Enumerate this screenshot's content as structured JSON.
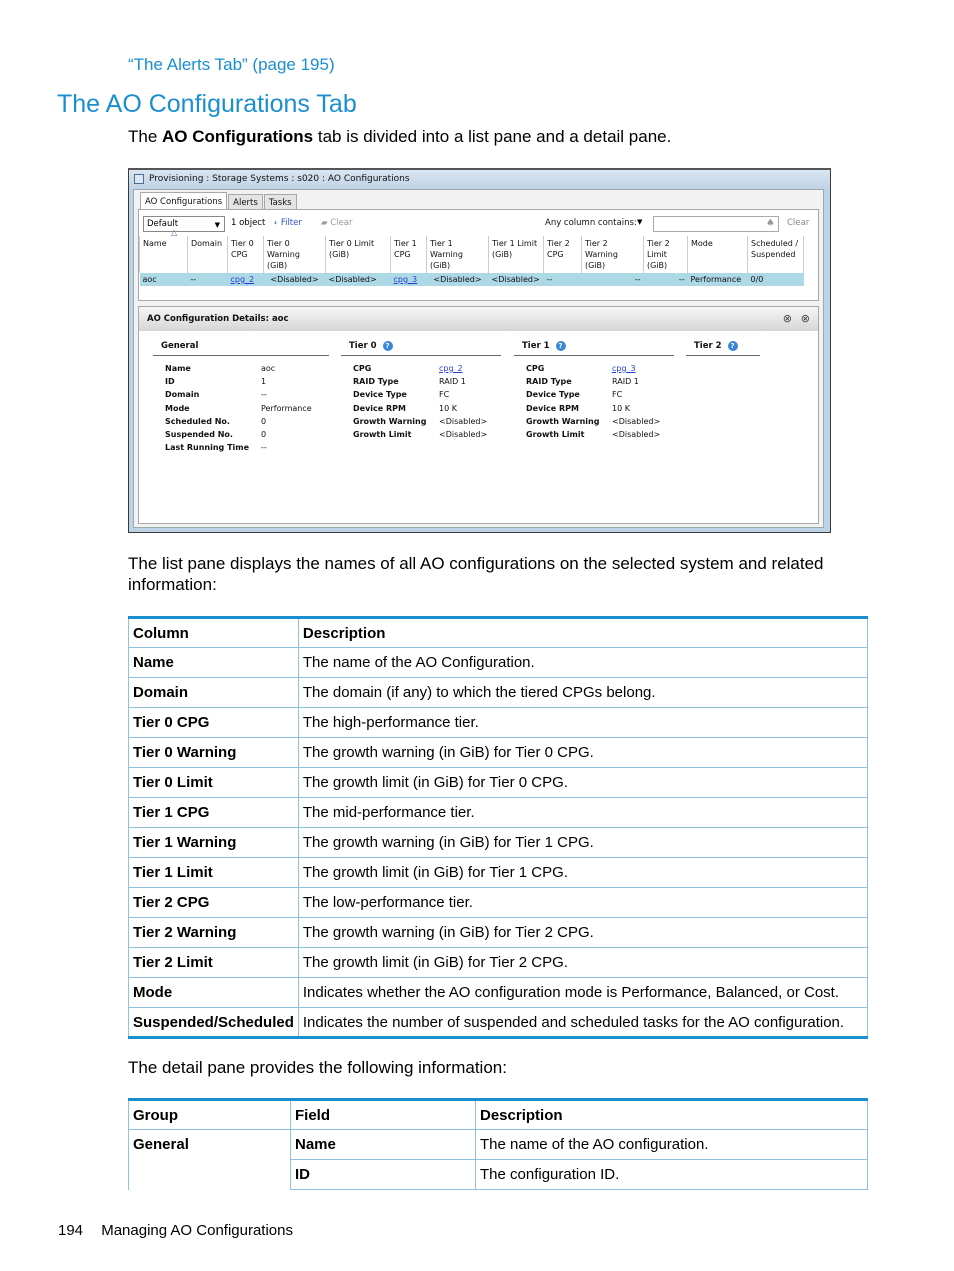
{
  "doc": {
    "xref_link": "“The Alerts Tab” (page 195)",
    "heading": "The AO Configurations Tab",
    "intro_prefix": "The ",
    "intro_bold": "AO Configurations",
    "intro_suffix": " tab is divided into a list pane and a detail pane.",
    "list_pane_para": "The list pane displays the names of all AO configurations on the selected system and related information:",
    "detail_pane_para": "The detail pane provides the following information:",
    "footer_page": "194",
    "footer_title": "Managing AO Configurations"
  },
  "screenshot": {
    "title": "Provisioning : Storage Systems : s020 : AO Configurations",
    "tabs": [
      "AO Configurations",
      "Alerts",
      "Tasks"
    ],
    "toolbar": {
      "view_select": "Default",
      "object_count": "1 object",
      "filter_label": "Filter",
      "clear_label": "Clear",
      "any_column_label": "Any column contains:",
      "search_value": "",
      "search_clear_label": "Clear"
    },
    "grid": {
      "columns": [
        [
          "Name",
          ""
        ],
        [
          "Domain",
          ""
        ],
        [
          "Tier 0",
          "CPG"
        ],
        [
          "Tier 0",
          "Warning (GiB)"
        ],
        [
          "Tier 0 Limit",
          "(GiB)"
        ],
        [
          "Tier 1",
          "CPG"
        ],
        [
          "Tier 1",
          "Warning (GiB)"
        ],
        [
          "Tier 1 Limit",
          "(GiB)"
        ],
        [
          "Tier 2",
          "CPG"
        ],
        [
          "Tier 2",
          "Warning (GiB)"
        ],
        [
          "Tier 2",
          "Limit (GiB)"
        ],
        [
          "Mode",
          ""
        ],
        [
          "Scheduled /",
          "Suspended"
        ]
      ],
      "rows": [
        [
          "aoc",
          "--",
          "cpg_2",
          "<Disabled>",
          "<Disabled>",
          "cpg_3",
          "<Disabled>",
          "<Disabled>",
          "--",
          "--",
          "--",
          "Performance",
          "0/0"
        ]
      ]
    },
    "detail": {
      "title": "AO Configuration Details: aoc",
      "groups": {
        "general": {
          "title": "General",
          "rows": [
            [
              "Name",
              "aoc"
            ],
            [
              "ID",
              "1"
            ],
            [
              "Domain",
              "--"
            ],
            [
              "Mode",
              "Performance"
            ],
            [
              "Scheduled No.",
              "0"
            ],
            [
              "Suspended No.",
              "0"
            ],
            [
              "Last Running Time",
              "--"
            ]
          ]
        },
        "tier0": {
          "title": "Tier 0",
          "rows": [
            [
              "CPG",
              "cpg_2"
            ],
            [
              "RAID Type",
              "RAID 1"
            ],
            [
              "Device Type",
              "FC"
            ],
            [
              "Device RPM",
              "10 K"
            ],
            [
              "Growth Warning",
              "<Disabled>"
            ],
            [
              "Growth Limit",
              "<Disabled>"
            ]
          ]
        },
        "tier1": {
          "title": "Tier 1",
          "rows": [
            [
              "CPG",
              "cpg_3"
            ],
            [
              "RAID Type",
              "RAID 1"
            ],
            [
              "Device Type",
              "FC"
            ],
            [
              "Device RPM",
              "10 K"
            ],
            [
              "Growth Warning",
              "<Disabled>"
            ],
            [
              "Growth Limit",
              "<Disabled>"
            ]
          ]
        },
        "tier2": {
          "title": "Tier 2",
          "rows": []
        }
      }
    }
  },
  "column_table": {
    "headers": [
      "Column",
      "Description"
    ],
    "rows": [
      [
        "Name",
        "The name of the AO Configuration."
      ],
      [
        "Domain",
        "The domain (if any) to which the tiered CPGs belong."
      ],
      [
        "Tier 0 CPG",
        "The high-performance tier."
      ],
      [
        "Tier 0 Warning",
        "The growth warning (in GiB) for Tier 0 CPG."
      ],
      [
        "Tier 0 Limit",
        "The growth limit (in GiB) for Tier 0 CPG."
      ],
      [
        "Tier 1 CPG",
        "The mid-performance tier."
      ],
      [
        "Tier 1 Warning",
        "The growth warning (in GiB) for Tier 1 CPG."
      ],
      [
        "Tier 1 Limit",
        "The growth limit (in GiB) for Tier 1 CPG."
      ],
      [
        "Tier 2 CPG",
        "The low-performance tier."
      ],
      [
        "Tier 2 Warning",
        "The growth warning (in GiB) for Tier 2 CPG."
      ],
      [
        "Tier 2 Limit",
        "The growth limit (in GiB) for Tier 2 CPG."
      ],
      [
        "Mode",
        "Indicates whether the AO configuration mode is Performance, Balanced, or Cost."
      ],
      [
        "Suspended/Scheduled",
        "Indicates the number of suspended and scheduled tasks for the AO configuration."
      ]
    ]
  },
  "detail_table": {
    "headers": [
      "Group",
      "Field",
      "Description"
    ],
    "rows": [
      [
        "General",
        "Name",
        "The name of the AO configuration."
      ],
      [
        "",
        "ID",
        "The configuration ID."
      ]
    ]
  }
}
